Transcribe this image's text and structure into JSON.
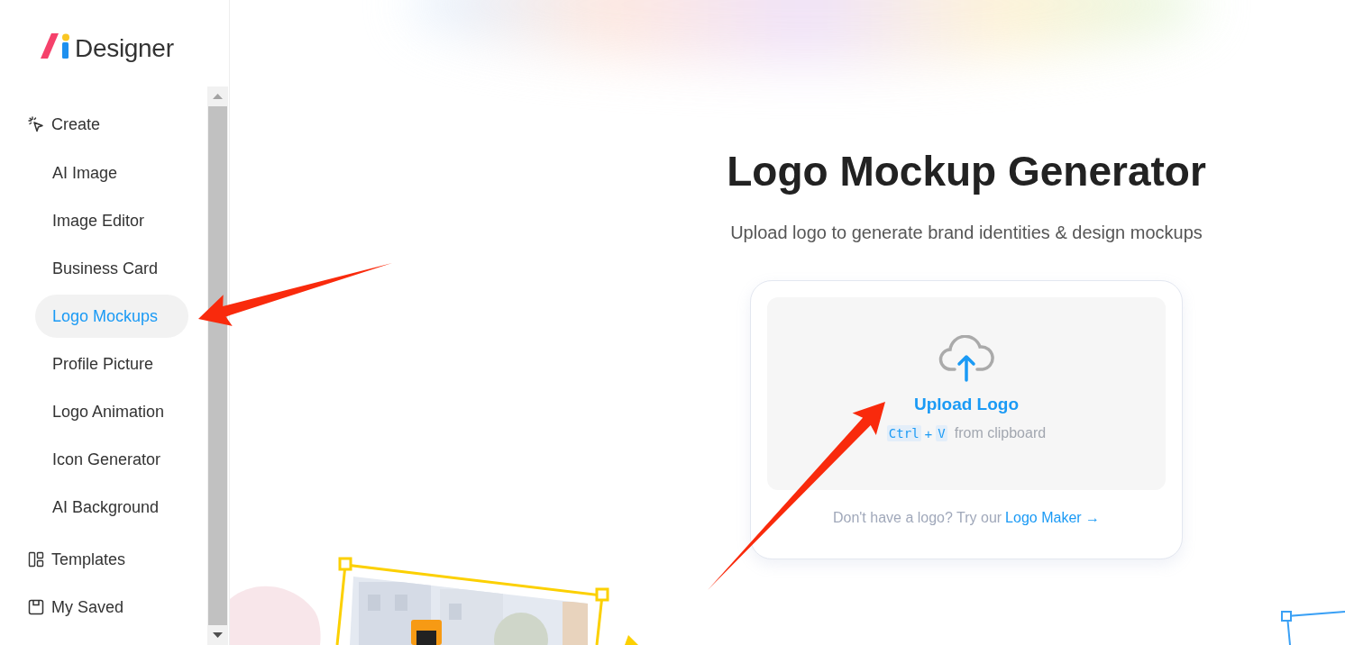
{
  "logo": {
    "text": "Designer"
  },
  "sidebar": {
    "sections": [
      {
        "label": "Create",
        "children": [
          {
            "label": "AI Image",
            "selected": false
          },
          {
            "label": "Image Editor",
            "selected": false
          },
          {
            "label": "Business Card",
            "selected": false
          },
          {
            "label": "Logo Mockups",
            "selected": true
          },
          {
            "label": "Profile Picture",
            "selected": false
          },
          {
            "label": "Logo Animation",
            "selected": false
          },
          {
            "label": "Icon Generator",
            "selected": false
          },
          {
            "label": "AI Background",
            "selected": false
          }
        ]
      },
      {
        "label": "Templates"
      },
      {
        "label": "My Saved"
      }
    ]
  },
  "main": {
    "title": "Logo Mockup Generator",
    "subtitle": "Upload logo to generate brand identities & design mockups",
    "upload": {
      "label": "Upload Logo",
      "keys": [
        "Ctrl",
        "V"
      ],
      "joiner": "+",
      "hint": "from clipboard"
    },
    "footer": {
      "text": "Don't have a logo? Try our",
      "link": "Logo Maker →"
    }
  }
}
